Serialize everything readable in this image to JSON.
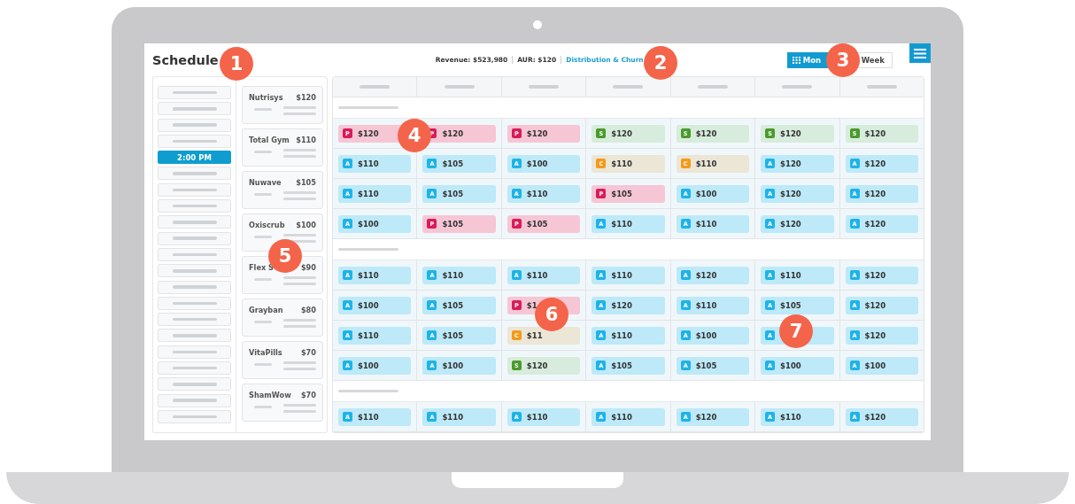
{
  "title": "Schedule",
  "stats": [
    {
      "kind": "stat",
      "text": "Revenue: $523,980"
    },
    {
      "kind": "stat",
      "text": "AUR: $120"
    },
    {
      "kind": "link",
      "text": "Distribution & Churn"
    }
  ],
  "view_toggle": [
    {
      "label": "Mon",
      "selected": true
    },
    {
      "label": "Week",
      "selected": false
    }
  ],
  "time_slots": [
    {
      "selected": false
    },
    {
      "selected": false
    },
    {
      "selected": false
    },
    {
      "selected": false
    },
    {
      "selected": true,
      "label": "2:00 PM"
    },
    {
      "selected": false
    },
    {
      "selected": false
    },
    {
      "selected": false
    },
    {
      "selected": false
    },
    {
      "selected": false
    },
    {
      "selected": false
    },
    {
      "selected": false
    },
    {
      "selected": false
    },
    {
      "selected": false
    },
    {
      "selected": false
    },
    {
      "selected": false
    },
    {
      "selected": false
    },
    {
      "selected": false
    },
    {
      "selected": false
    },
    {
      "selected": false
    },
    {
      "selected": false
    }
  ],
  "products": [
    {
      "name": "Nutrisys",
      "price": "$120"
    },
    {
      "name": "Total Gym",
      "price": "$110"
    },
    {
      "name": "Nuwave",
      "price": "$105"
    },
    {
      "name": "Oxiscrub",
      "price": "$100"
    },
    {
      "name": "Flex S",
      "price": "$90"
    },
    {
      "name": "Grayban",
      "price": "$80"
    },
    {
      "name": "VitaPills",
      "price": "$70"
    },
    {
      "name": "ShamWow",
      "price": "$70"
    }
  ],
  "groups": [
    {
      "rows": [
        [
          {
            "kind": "p",
            "badge": "P",
            "amount": "$120"
          },
          {
            "kind": "p",
            "badge": "P",
            "amount": "$120"
          },
          {
            "kind": "p",
            "badge": "P",
            "amount": "$120"
          },
          {
            "kind": "s",
            "badge": "S",
            "amount": "$120"
          },
          {
            "kind": "s",
            "badge": "S",
            "amount": "$120"
          },
          {
            "kind": "s",
            "badge": "S",
            "amount": "$120"
          },
          {
            "kind": "s",
            "badge": "S",
            "amount": "$120"
          }
        ],
        [
          {
            "kind": "a",
            "badge": "A",
            "amount": "$110"
          },
          {
            "kind": "a",
            "badge": "A",
            "amount": "$105"
          },
          {
            "kind": "a",
            "badge": "A",
            "amount": "$100"
          },
          {
            "kind": "c",
            "badge": "C",
            "amount": "$110"
          },
          {
            "kind": "c",
            "badge": "C",
            "amount": "$110"
          },
          {
            "kind": "a",
            "badge": "A",
            "amount": "$120"
          },
          {
            "kind": "a",
            "badge": "A",
            "amount": "$120"
          }
        ],
        [
          {
            "kind": "a",
            "badge": "A",
            "amount": "$110"
          },
          {
            "kind": "a",
            "badge": "A",
            "amount": "$105"
          },
          {
            "kind": "a",
            "badge": "A",
            "amount": "$110"
          },
          {
            "kind": "p",
            "badge": "P",
            "amount": "$105"
          },
          {
            "kind": "a",
            "badge": "A",
            "amount": "$100"
          },
          {
            "kind": "a",
            "badge": "A",
            "amount": "$120"
          },
          {
            "kind": "a",
            "badge": "A",
            "amount": "$120"
          }
        ],
        [
          {
            "kind": "a",
            "badge": "A",
            "amount": "$100"
          },
          {
            "kind": "p",
            "badge": "P",
            "amount": "$105"
          },
          {
            "kind": "p",
            "badge": "P",
            "amount": "$105"
          },
          {
            "kind": "a",
            "badge": "A",
            "amount": "$110"
          },
          {
            "kind": "a",
            "badge": "A",
            "amount": "$110"
          },
          {
            "kind": "a",
            "badge": "A",
            "amount": "$120"
          },
          {
            "kind": "a",
            "badge": "A",
            "amount": "$120"
          }
        ]
      ]
    },
    {
      "rows": [
        [
          {
            "kind": "a",
            "badge": "A",
            "amount": "$110"
          },
          {
            "kind": "a",
            "badge": "A",
            "amount": "$110"
          },
          {
            "kind": "a",
            "badge": "A",
            "amount": "$110"
          },
          {
            "kind": "a",
            "badge": "A",
            "amount": "$110"
          },
          {
            "kind": "a",
            "badge": "A",
            "amount": "$120"
          },
          {
            "kind": "a",
            "badge": "A",
            "amount": "$110"
          },
          {
            "kind": "a",
            "badge": "A",
            "amount": "$120"
          }
        ],
        [
          {
            "kind": "a",
            "badge": "A",
            "amount": "$100"
          },
          {
            "kind": "a",
            "badge": "A",
            "amount": "$105"
          },
          {
            "kind": "p",
            "badge": "P",
            "amount": "$1"
          },
          {
            "kind": "a",
            "badge": "A",
            "amount": "$120"
          },
          {
            "kind": "a",
            "badge": "A",
            "amount": "$110"
          },
          {
            "kind": "a",
            "badge": "A",
            "amount": "$105"
          },
          {
            "kind": "a",
            "badge": "A",
            "amount": "$120"
          }
        ],
        [
          {
            "kind": "a",
            "badge": "A",
            "amount": "$110"
          },
          {
            "kind": "a",
            "badge": "A",
            "amount": "$105"
          },
          {
            "kind": "c",
            "badge": "C",
            "amount": "$11"
          },
          {
            "kind": "a",
            "badge": "A",
            "amount": "$110"
          },
          {
            "kind": "a",
            "badge": "A",
            "amount": "$100"
          },
          {
            "kind": "a",
            "badge": "A"
          },
          {
            "kind": "a",
            "badge": "A",
            "amount": "$120"
          }
        ],
        [
          {
            "kind": "a",
            "badge": "A",
            "amount": "$100"
          },
          {
            "kind": "a",
            "badge": "A",
            "amount": "$100"
          },
          {
            "kind": "s",
            "badge": "S",
            "amount": "$120"
          },
          {
            "kind": "a",
            "badge": "A",
            "amount": "$105"
          },
          {
            "kind": "a",
            "badge": "A",
            "amount": "$105"
          },
          {
            "kind": "a",
            "badge": "A",
            "amount": "$100"
          },
          {
            "kind": "a",
            "badge": "A",
            "amount": "$100"
          }
        ]
      ]
    },
    {
      "rows": [
        [
          {
            "kind": "a",
            "badge": "A",
            "amount": "$110"
          },
          {
            "kind": "a",
            "badge": "A",
            "amount": "$110"
          },
          {
            "kind": "a",
            "badge": "A",
            "amount": "$110"
          },
          {
            "kind": "a",
            "badge": "A",
            "amount": "$110"
          },
          {
            "kind": "a",
            "badge": "A",
            "amount": "$120"
          },
          {
            "kind": "a",
            "badge": "A",
            "amount": "$110"
          },
          {
            "kind": "a",
            "badge": "A",
            "amount": "$120"
          }
        ]
      ]
    }
  ],
  "callouts": [
    {
      "label": "1"
    },
    {
      "label": "2"
    },
    {
      "label": "3"
    },
    {
      "label": "4"
    },
    {
      "label": "5"
    },
    {
      "label": "6"
    },
    {
      "label": "7"
    }
  ]
}
